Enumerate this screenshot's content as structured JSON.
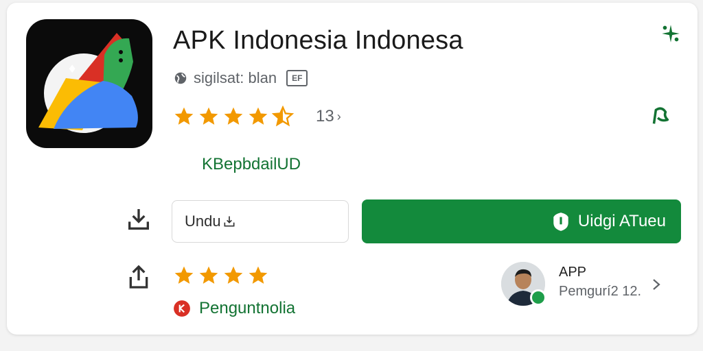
{
  "app": {
    "title": "APK Indonesia Indonesa",
    "subtitle": "sigilsat: blan",
    "badge": "EF",
    "rating_count": "13",
    "rating_suffix": "›",
    "category": "KBepbdailUD"
  },
  "rating": {
    "stars": 4.5,
    "max": 5
  },
  "actions": {
    "download_label": "Undu",
    "install_label": "Uidgi ATueu"
  },
  "review": {
    "stars": 4,
    "developer_label": "Penguntnolia",
    "reviewer_name": "APP",
    "reviewer_meta": "Pemgurí2 12."
  },
  "colors": {
    "accent_green": "#138a3c",
    "star": "#f29900",
    "text_green": "#137333",
    "dev_red": "#d93025"
  },
  "icons": {
    "top_right": "sparkle-icon",
    "mid_right": "flag-icon",
    "download": "download-icon",
    "share": "share-icon",
    "subtitle": "globe-icon",
    "install": "shield-icon",
    "chevron": "chevron-right-icon"
  }
}
